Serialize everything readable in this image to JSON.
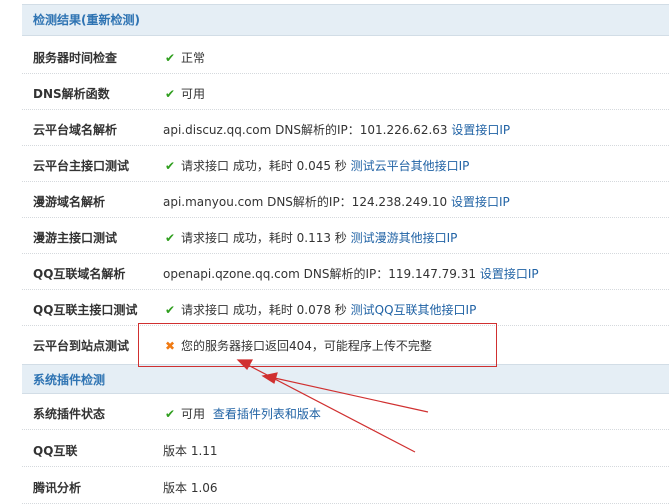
{
  "sections": {
    "detect_title": "检测结果(重新检测)",
    "plugin_title": "系统插件检测"
  },
  "detect": {
    "server_time": {
      "label": "服务器时间检查",
      "status": "正常"
    },
    "dns_func": {
      "label": "DNS解析函数",
      "status": "可用"
    },
    "cloud_dns": {
      "label": "云平台域名解析",
      "text": "api.discuz.qq.com DNS解析的IP：101.226.62.63",
      "link": "设置接口IP"
    },
    "cloud_api": {
      "label": "云平台主接口测试",
      "text": "请求接口 成功，耗时 0.045 秒",
      "link": "测试云平台其他接口IP"
    },
    "manyou_dns": {
      "label": "漫游域名解析",
      "text": "api.manyou.com DNS解析的IP：124.238.249.10",
      "link": "设置接口IP"
    },
    "manyou_api": {
      "label": "漫游主接口测试",
      "text": "请求接口 成功，耗时 0.113 秒",
      "link": "测试漫游其他接口IP"
    },
    "qq_dns": {
      "label": "QQ互联域名解析",
      "text": "openapi.qzone.qq.com DNS解析的IP：119.147.79.31",
      "link": "设置接口IP"
    },
    "qq_api": {
      "label": "QQ互联主接口测试",
      "text": "请求接口 成功，耗时 0.078 秒",
      "link": "测试QQ互联其他接口IP"
    },
    "cloud_site": {
      "label": "云平台到站点测试",
      "text": "您的服务器接口返回404，可能程序上传不完整"
    }
  },
  "plugins": {
    "status": {
      "label": "系统插件状态",
      "text": "可用",
      "link": "查看插件列表和版本"
    },
    "qq_connect": {
      "label": "QQ互联",
      "text": "版本 1.11"
    },
    "tencent_analytics": {
      "label": "腾讯分析",
      "text": "版本 1.06"
    }
  },
  "colors": {
    "section_bg": "#e5eef5",
    "section_text": "#2f74b3",
    "ok_icon": "#2f9e1e",
    "error_icon": "#f07a13",
    "link": "#2163a5",
    "annotation": "#d03030"
  },
  "icons": {
    "ok": "check-icon",
    "error": "cross-icon"
  }
}
